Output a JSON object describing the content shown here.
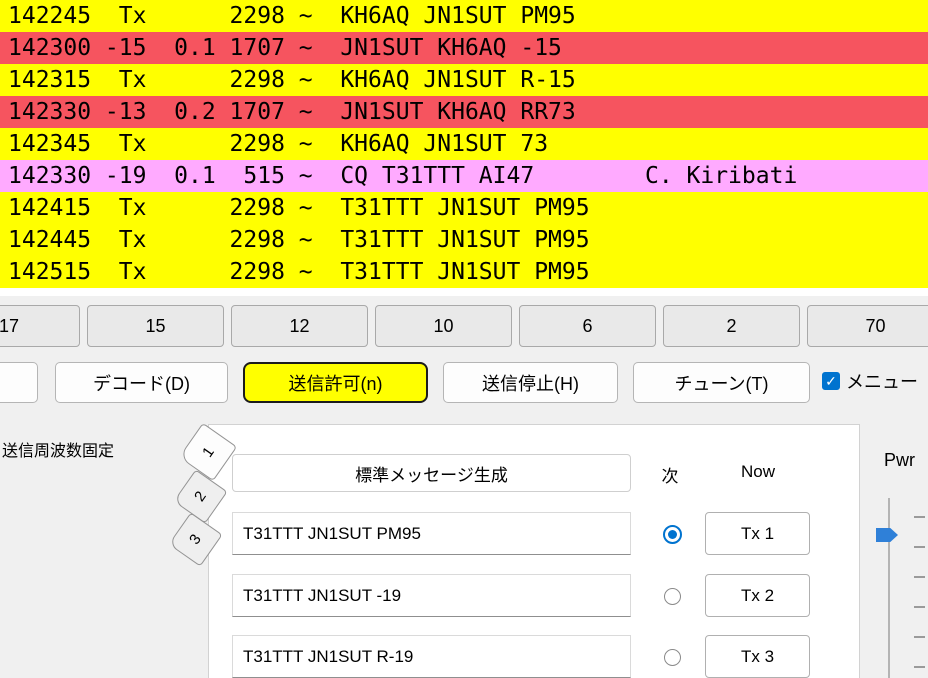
{
  "decode_log": {
    "rows": [
      {
        "text": "142245  Tx      2298 ~  KH6AQ JN1SUT PM95",
        "highlight": "yellow"
      },
      {
        "text": "142300 -15  0.1 1707 ~  JN1SUT KH6AQ -15",
        "highlight": "red"
      },
      {
        "text": "142315  Tx      2298 ~  KH6AQ JN1SUT R-15",
        "highlight": "yellow"
      },
      {
        "text": "142330 -13  0.2 1707 ~  JN1SUT KH6AQ RR73",
        "highlight": "red"
      },
      {
        "text": "142345  Tx      2298 ~  KH6AQ JN1SUT 73",
        "highlight": "yellow"
      },
      {
        "text": "142330 -19  0.1  515 ~  CQ T31TTT AI47        C. Kiribati",
        "highlight": "pink"
      },
      {
        "text": "142415  Tx      2298 ~  T31TTT JN1SUT PM95",
        "highlight": "yellow"
      },
      {
        "text": "142445  Tx      2298 ~  T31TTT JN1SUT PM95",
        "highlight": "yellow"
      },
      {
        "text": "142515  Tx      2298 ~  T31TTT JN1SUT PM95",
        "highlight": "yellow"
      }
    ]
  },
  "band_buttons": {
    "labels": [
      "17",
      "15",
      "12",
      "10",
      "6",
      "2",
      "70"
    ]
  },
  "controls": {
    "decode_label": "デコード(D)",
    "enable_tx_label": "送信許可(n)",
    "halt_tx_label": "送信停止(H)",
    "tune_label": "チューン(T)",
    "menus_label": "メニュー",
    "menus_checked": true
  },
  "tx_panel": {
    "hold_tx_freq_label": "送信周波数固定",
    "tabs": [
      "1",
      "2",
      "3"
    ],
    "generate_std_msgs_label": "標準メッセージ生成",
    "next_header": "次",
    "now_header": "Now",
    "rows": [
      {
        "message": "T31TTT JN1SUT PM95",
        "button": "Tx 1",
        "selected": true
      },
      {
        "message": "T31TTT JN1SUT -19",
        "button": "Tx 2",
        "selected": false
      },
      {
        "message": "T31TTT JN1SUT R-19",
        "button": "Tx 3",
        "selected": false
      }
    ],
    "pwr_label": "Pwr"
  },
  "icons": {
    "check": "✓"
  },
  "colors": {
    "tx_highlight": "#ffff00",
    "mycall_highlight": "#f6545f",
    "new_dxcc_highlight": "#ffaaff",
    "accent_blue": "#0073cf",
    "enable_tx_bg": "#ffff00"
  }
}
